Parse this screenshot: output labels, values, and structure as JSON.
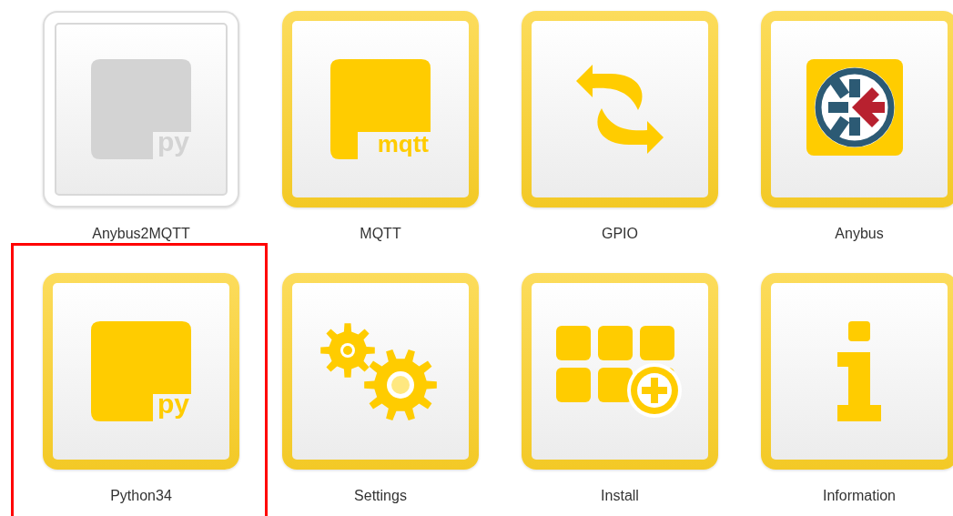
{
  "apps": [
    {
      "label": "Anybus2MQTT",
      "kind": "python",
      "badge": "py",
      "disabled": true,
      "selected": false
    },
    {
      "label": "MQTT",
      "kind": "mqtt",
      "badge": "mqtt",
      "disabled": false,
      "selected": false
    },
    {
      "label": "GPIO",
      "kind": "sync",
      "disabled": false,
      "selected": false
    },
    {
      "label": "Anybus",
      "kind": "anybus",
      "disabled": false,
      "selected": false
    },
    {
      "label": "Python34",
      "kind": "python",
      "badge": "py",
      "disabled": false,
      "selected": true
    },
    {
      "label": "Settings",
      "kind": "gears",
      "disabled": false,
      "selected": false
    },
    {
      "label": "Install",
      "kind": "install",
      "disabled": false,
      "selected": false
    },
    {
      "label": "Information",
      "kind": "info",
      "disabled": false,
      "selected": false
    }
  ]
}
